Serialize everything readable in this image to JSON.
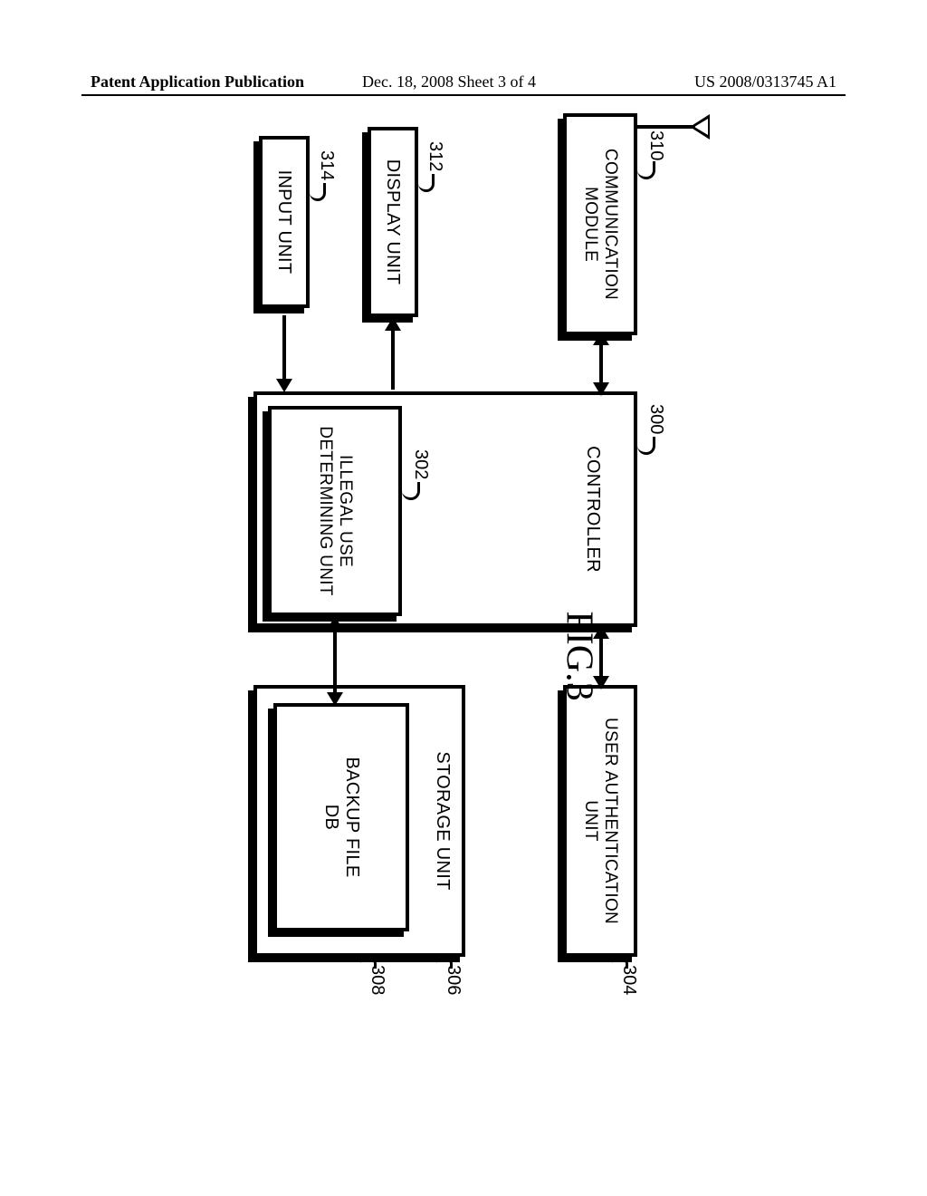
{
  "header": {
    "left": "Patent Application Publication",
    "mid": "Dec. 18, 2008  Sheet 3 of 4",
    "right": "US 2008/0313745 A1"
  },
  "blocks": {
    "comm": {
      "label": "COMMUNICATION\nMODULE",
      "ref": "310"
    },
    "display": {
      "label": "DISPLAY UNIT",
      "ref": "312"
    },
    "input": {
      "label": "INPUT UNIT",
      "ref": "314"
    },
    "controller": {
      "label": "CONTROLLER",
      "ref": "300"
    },
    "illegal": {
      "label": "ILLEGAL USE\nDETERMINING UNIT",
      "ref": "302"
    },
    "auth": {
      "label": "USER AUTHENTICATION\nUNIT",
      "ref": "304"
    },
    "storage": {
      "label": "STORAGE UNIT",
      "ref": "306"
    },
    "backup": {
      "label": "BACKUP FILE\nDB",
      "ref": "308"
    }
  },
  "figure_caption": "FIG.3"
}
